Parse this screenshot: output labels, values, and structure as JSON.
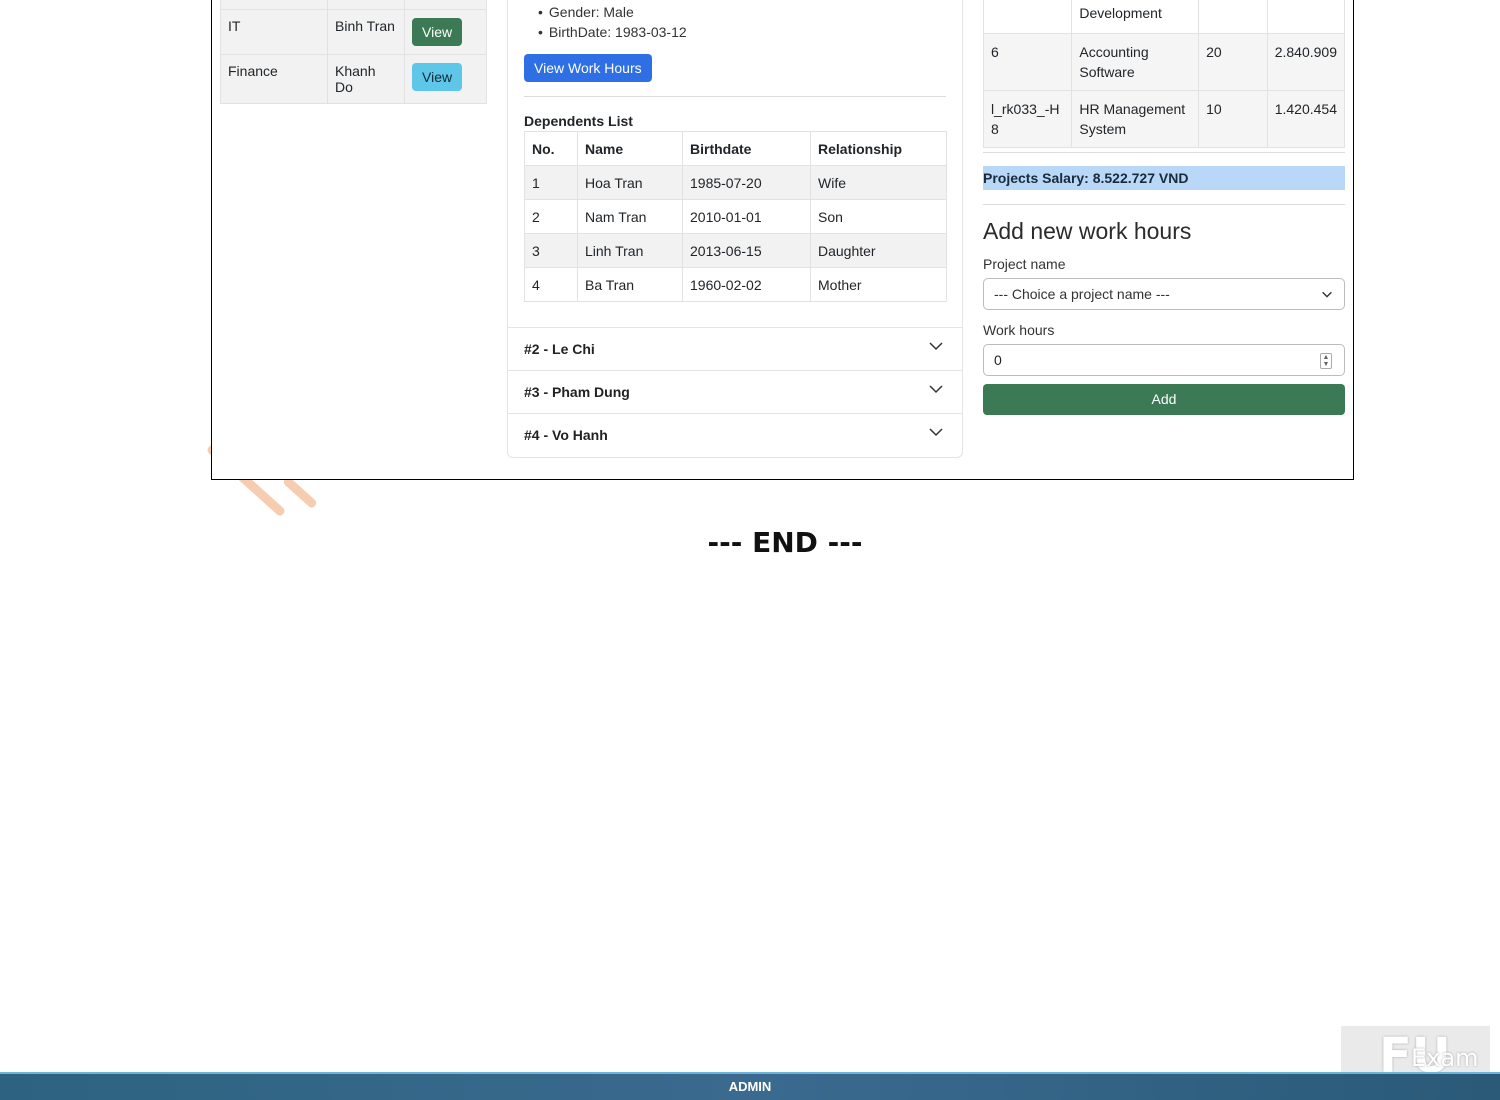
{
  "departments": [
    {
      "dept": "IT",
      "manager": "Binh Tran",
      "button": "View",
      "style": "green"
    },
    {
      "dept": "Finance",
      "manager": "Khanh Do",
      "button": "View",
      "style": "cyan"
    }
  ],
  "employee": {
    "gender": "Gender: Male",
    "birthdate": "BirthDate: 1983-03-12",
    "view_work_hours_label": "View Work Hours"
  },
  "dependents": {
    "title": "Dependents List",
    "headers": [
      "No.",
      "Name",
      "Birthdate",
      "Relationship"
    ],
    "rows": [
      [
        "1",
        "Hoa Tran",
        "1985-07-20",
        "Wife"
      ],
      [
        "2",
        "Nam Tran",
        "2010-01-01",
        "Son"
      ],
      [
        "3",
        "Linh Tran",
        "2013-06-15",
        "Daughter"
      ],
      [
        "4",
        "Ba Tran",
        "1960-02-02",
        "Mother"
      ]
    ]
  },
  "accordion": [
    "#2 - Le Chi",
    "#3 - Pham Dung",
    "#4 - Vo Hanh"
  ],
  "projects": [
    {
      "id": "",
      "name": "Development",
      "hours": "",
      "salary": ""
    },
    {
      "id": "6",
      "name": "Accounting Software",
      "hours": "20",
      "salary": "2.840.909"
    },
    {
      "id": "l_rk033_-H8",
      "name": "HR Management System",
      "hours": "10",
      "salary": "1.420.454"
    }
  ],
  "projects_salary": "Projects Salary: 8.522.727 VND",
  "add_form": {
    "title": "Add new work hours",
    "project_label": "Project name",
    "project_placeholder": "--- Choice a project name ---",
    "hours_label": "Work hours",
    "hours_value": "0",
    "submit_label": "Add"
  },
  "end_text": "--- END ---",
  "footer_text": "ADMIN",
  "colors": {
    "green": "#3b7a55",
    "cyan": "#5ec6e8",
    "blue": "#2f6fe4",
    "salary_bg": "#b9d8f8"
  }
}
